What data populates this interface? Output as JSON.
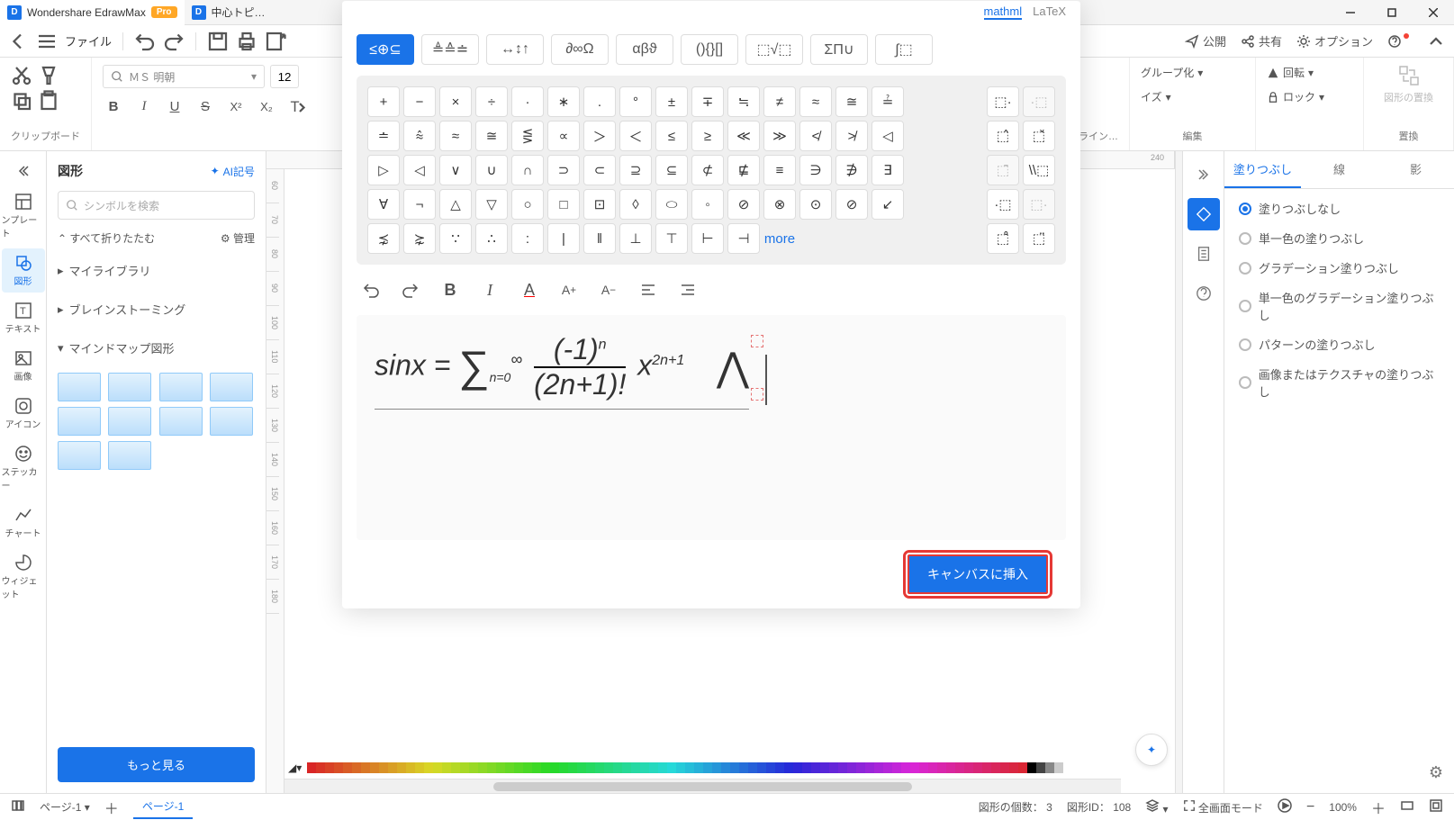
{
  "titlebar": {
    "app_name": "Wondershare EdrawMax",
    "pro": "Pro",
    "tab2": "中心トピ…"
  },
  "top_toolbar": {
    "file": "ファイル",
    "publish": "公開",
    "share": "共有",
    "options": "オプション"
  },
  "ribbon": {
    "clipboard_label": "クリップボード",
    "font_label": "フォントとアライン…",
    "font_name": "ＭＳ 明朝",
    "font_size": "12",
    "group": "グループ化",
    "rotate": "回転",
    "size": "イズ",
    "lock": "ロック",
    "edit_label": "編集",
    "replace_shape": "図形の置換",
    "replace_label": "置換"
  },
  "left_rail": {
    "template": "ンプレート",
    "shape": "図形",
    "text": "テキスト",
    "image": "画像",
    "icon": "アイコン",
    "sticker": "ステッカー",
    "chart": "チャート",
    "widget": "ウィジェット"
  },
  "left_panel": {
    "title": "図形",
    "ai_symbols": "AI記号",
    "search_placeholder": "シンボルを検索",
    "collapse_all": "すべて折りたたむ",
    "manage": "管理",
    "my_library": "マイライブラリ",
    "brainstorming": "ブレインストーミング",
    "mindmap": "マインドマップ図形",
    "more": "もっと見る"
  },
  "modal": {
    "top_tab1": "mathml",
    "top_tab2": "LaTeX",
    "categories": [
      "≤⊕⊆",
      "≜≙≐",
      "↔↕↑",
      "∂∞Ω",
      "αβϑ",
      "(){}[]",
      "⬚√⬚",
      "ΣΠ∪",
      "∫⬚"
    ],
    "symbols_row1": [
      "+",
      "−",
      "×",
      "÷",
      "·",
      "∗",
      ".",
      "°",
      "±",
      "∓",
      "≒",
      "≠",
      "≈",
      "≅",
      "≟"
    ],
    "symbols_row2": [
      "≐",
      "⩯",
      "≈",
      "≅",
      "⋚",
      "∝",
      "＞",
      "＜",
      "≤",
      "≥",
      "≪",
      "≫",
      "≮",
      "≯",
      "◁"
    ],
    "symbols_row3": [
      "▷",
      "◁",
      "∨",
      "∪",
      "∩",
      "⊃",
      "⊂",
      "⊇",
      "⊆",
      "⊄",
      "⋢",
      "≡",
      "∋",
      "∌",
      "∃"
    ],
    "symbols_row4": [
      "∀",
      "¬",
      "△",
      "▽",
      "○",
      "□",
      "⊡",
      "◊",
      "⬭",
      "◦",
      "⊘",
      "⊗",
      "⊙",
      "⊘",
      "↙"
    ],
    "symbols_row5": [
      "⋨",
      "⋩",
      "∵",
      "∴",
      ":",
      "|",
      "‖",
      "⊥",
      "⊤",
      "⊢",
      "⊣",
      "more"
    ],
    "side_cols": [
      "⬚·",
      "·⬚",
      "⬚̂",
      "⬚̌",
      "⬚̄",
      "\\\\⬚",
      "·⬚",
      "⬚·",
      "⬚̊",
      "⬚̈"
    ],
    "insert": "キャンバスに挿入"
  },
  "right_panel": {
    "tab_fill": "塗りつぶし",
    "tab_line": "線",
    "tab_shadow": "影",
    "fill_none": "塗りつぶしなし",
    "fill_solid": "単一色の塗りつぶし",
    "fill_gradient": "グラデーション塗りつぶし",
    "fill_solid_gradient": "単一色のグラデーション塗りつぶし",
    "fill_pattern": "パターンの塗りつぶし",
    "fill_texture": "画像またはテクスチャの塗りつぶし"
  },
  "statusbar": {
    "page": "ページ-1",
    "page_label": "ページ-1",
    "shape_count_label": "図形の個数：",
    "shape_count": "3",
    "shape_id_label": "図形ID：",
    "shape_id": "108",
    "fullscreen": "全画面モード",
    "zoom": "100%"
  },
  "ruler_h": [
    "240"
  ],
  "ruler_v": [
    "60",
    "70",
    "80",
    "90",
    "100",
    "110",
    "120",
    "130",
    "140",
    "150",
    "160",
    "170",
    "180"
  ]
}
